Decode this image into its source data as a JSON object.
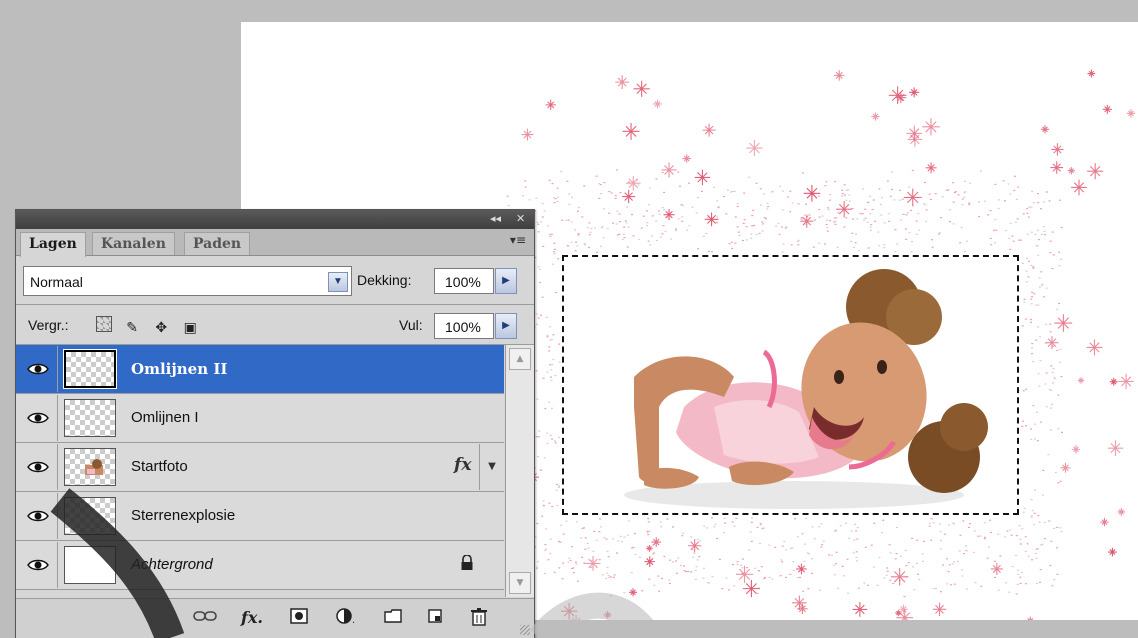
{
  "panel": {
    "tabs": [
      "Lagen",
      "Kanalen",
      "Paden"
    ],
    "collapse_glyph": "◂◂",
    "close_glyph": "✕",
    "menu_glyph": "▾≡",
    "blend_mode": "Normaal",
    "opacity_label": "Dekking:",
    "opacity_value": "100%",
    "lock_label": "Vergr.:",
    "fill_label": "Vul:",
    "fill_value": "100%"
  },
  "layers": [
    {
      "name": "Omlijnen II",
      "selected": true,
      "thumb": "transparent"
    },
    {
      "name": "Omlijnen I",
      "selected": false,
      "thumb": "transparent"
    },
    {
      "name": "Startfoto",
      "selected": false,
      "thumb": "photo",
      "fx": "fx"
    },
    {
      "name": "Sterrenexplosie",
      "selected": false,
      "thumb": "transparent"
    },
    {
      "name": "Achtergrond",
      "selected": false,
      "thumb": "white",
      "locked": true
    }
  ],
  "footer_icons": [
    "link-icon",
    "fx-icon",
    "mask-icon",
    "adjustment-icon",
    "folder-icon",
    "new-layer-icon",
    "trash-icon"
  ],
  "colors": {
    "selection": "#3169c6",
    "sparkle": "#e0566e",
    "panel_bg": "#d6d6d6",
    "workspace": "#bdbdbd"
  }
}
